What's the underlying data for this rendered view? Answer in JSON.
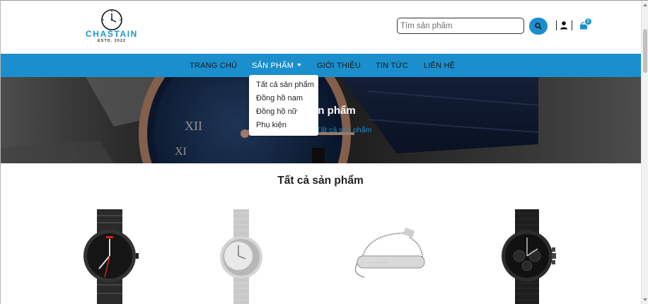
{
  "header": {
    "brand": "CHASTAIN",
    "brand_sub": "ESTD. 2022",
    "search_placeholder": "Tìm sản phẩm",
    "cart_count": "0"
  },
  "nav": {
    "items": [
      {
        "label": "TRANG CHỦ"
      },
      {
        "label": "SẢN PHẨM"
      },
      {
        "label": "GIỚI THIỆU"
      },
      {
        "label": "TIN TỨC"
      },
      {
        "label": "LIÊN HỆ"
      }
    ]
  },
  "dropdown": {
    "items": [
      {
        "label": "Tất cả sản phẩm"
      },
      {
        "label": "Đồng hồ nam"
      },
      {
        "label": "Đồng hồ nữ"
      },
      {
        "label": "Phụ kiện"
      }
    ]
  },
  "banner": {
    "title": "ản phẩm",
    "breadcrumb": "Tất cả sản phẩm"
  },
  "section": {
    "title": "Tất cả sản phẩm"
  },
  "products": [
    {
      "icon": "black-steel-watch-image"
    },
    {
      "icon": "silver-mesh-watch-image"
    },
    {
      "icon": "silver-bracelet-image"
    },
    {
      "icon": "black-mesh-chronograph-image"
    }
  ],
  "colors": {
    "accent": "#1b8fcd",
    "brand": "#1d95d2"
  }
}
